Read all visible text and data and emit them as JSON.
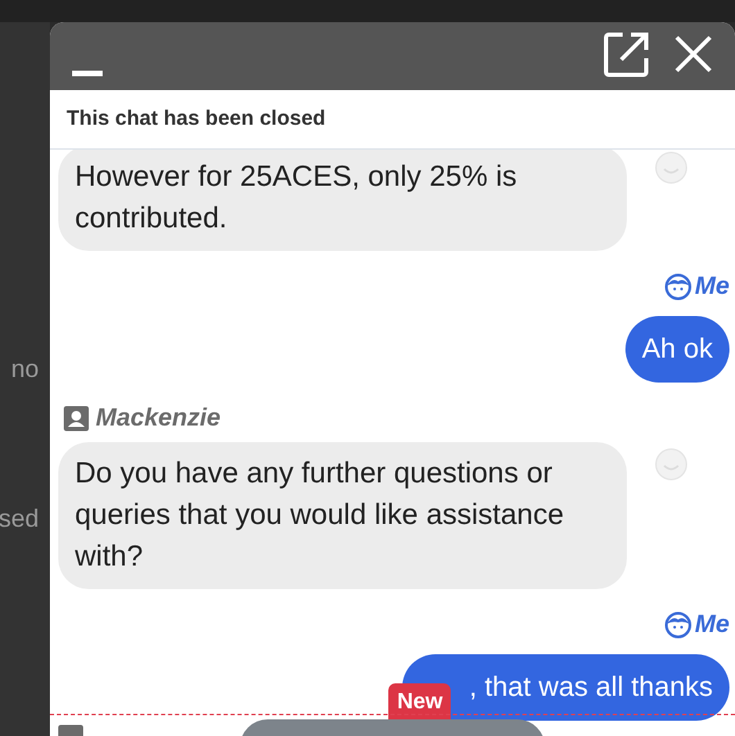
{
  "background_texts": [
    "no",
    "sed"
  ],
  "window": {
    "status": "This chat has been closed"
  },
  "messages": [
    {
      "kind": "agent",
      "text": "However for 25ACES, only 25% is contributed."
    },
    {
      "kind": "me",
      "sender": "Me",
      "text": "Ah ok"
    },
    {
      "kind": "agent",
      "sender": "Mackenzie",
      "text": "Do you have any further questions or queries that you would like assistance with?"
    },
    {
      "kind": "me",
      "sender": "Me",
      "text": ", that was all thanks",
      "badge": "New"
    }
  ]
}
